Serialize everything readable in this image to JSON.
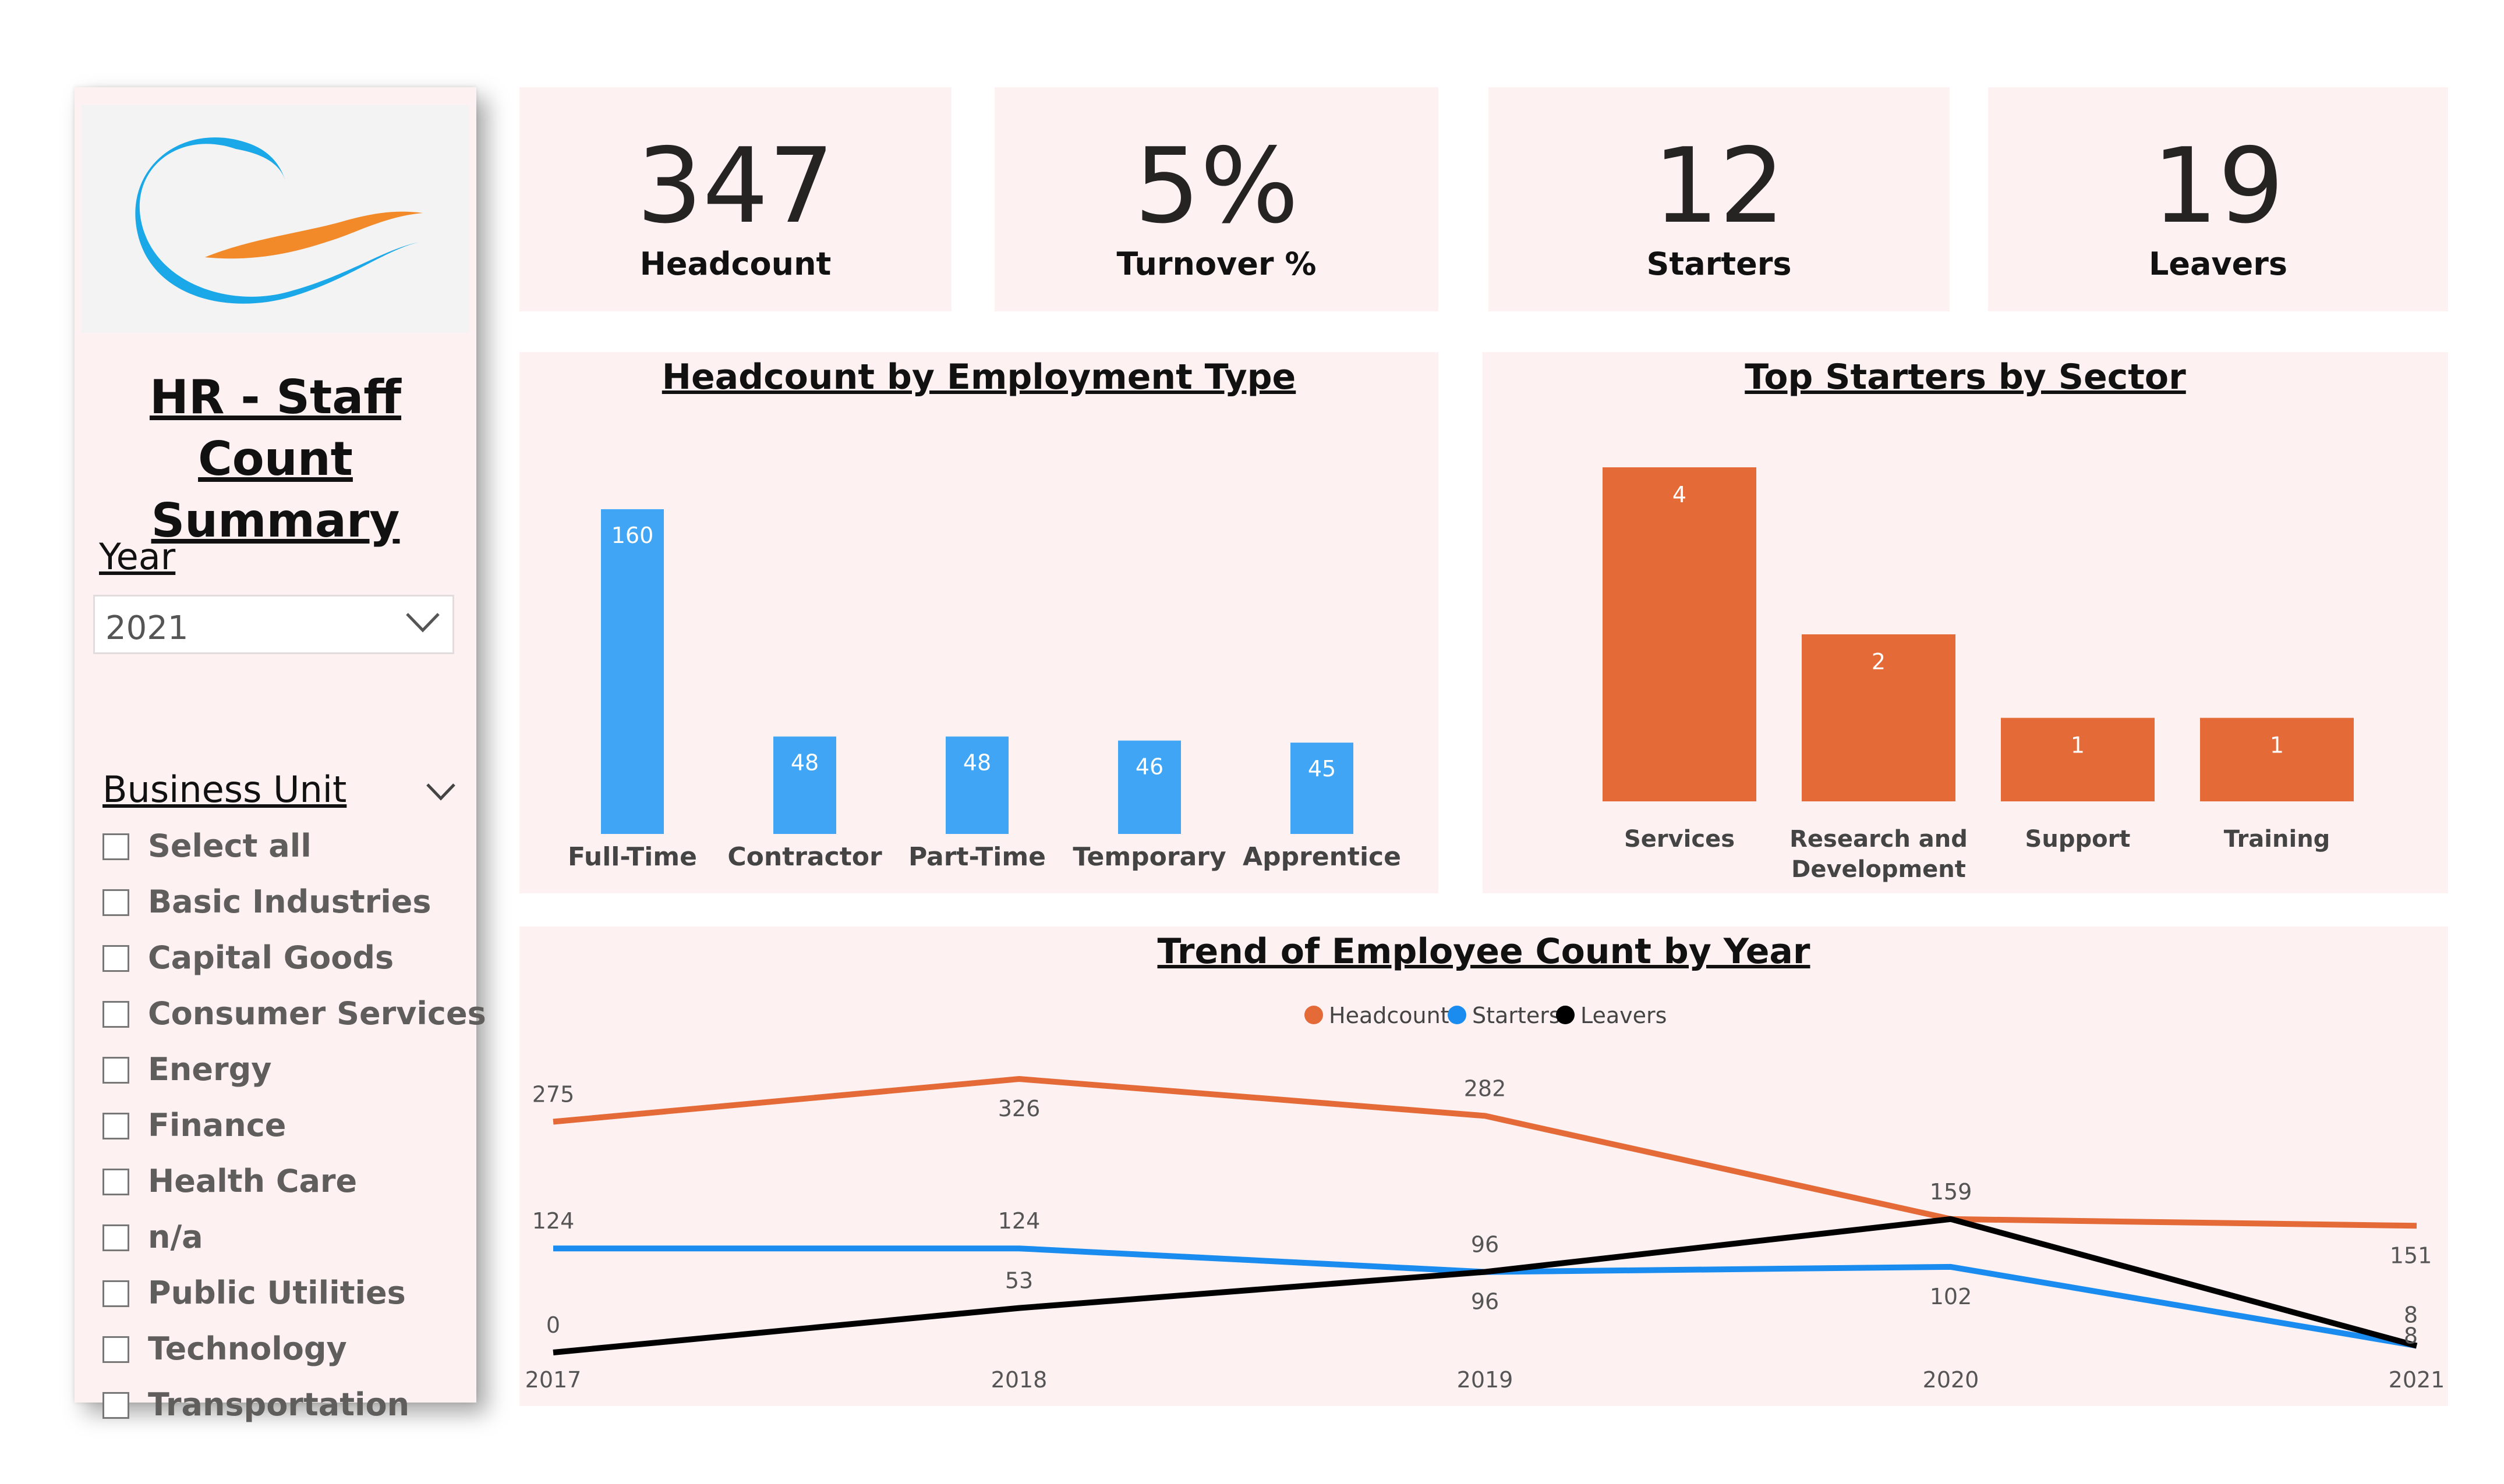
{
  "sidebar": {
    "title_line1": "HR - Staff Count",
    "title_line2": "Summary",
    "year_label": "Year",
    "year_value": "2021",
    "business_unit_label": "Business Unit",
    "business_units": [
      "Select all",
      "Basic Industries",
      "Capital Goods",
      "Consumer Services",
      "Energy",
      "Finance",
      "Health Care",
      "n/a",
      "Public Utilities",
      "Technology",
      "Transportation"
    ],
    "logo_colors": {
      "blue": "#1aa8e8",
      "orange": "#f28a2a"
    }
  },
  "kpis": [
    {
      "value": "347",
      "label": "Headcount"
    },
    {
      "value": "5%",
      "label": "Turnover %"
    },
    {
      "value": "12",
      "label": "Starters"
    },
    {
      "value": "19",
      "label": "Leavers"
    }
  ],
  "chart_data": [
    {
      "type": "bar",
      "title": "Headcount by Employment Type",
      "categories": [
        "Full-Time",
        "Contractor",
        "Part-Time",
        "Temporary",
        "Apprentice"
      ],
      "values": [
        160,
        48,
        48,
        46,
        45
      ],
      "color": "#41a5f5",
      "ylim": [
        0,
        160
      ]
    },
    {
      "type": "bar",
      "title": "Top Starters by Sector",
      "categories": [
        "Services",
        "Research and Development",
        "Support",
        "Training"
      ],
      "values": [
        4,
        2,
        1,
        1
      ],
      "color": "#e46a38",
      "ylim": [
        0,
        4
      ]
    },
    {
      "type": "line",
      "title": "Trend of Employee Count by Year",
      "x": [
        "2017",
        "2018",
        "2019",
        "2020",
        "2021"
      ],
      "series": [
        {
          "name": "Headcount",
          "values": [
            275,
            326,
            282,
            159,
            151
          ],
          "color": "#e46a38"
        },
        {
          "name": "Starters",
          "values": [
            124,
            124,
            96,
            102,
            8
          ],
          "color": "#1a8cf0"
        },
        {
          "name": "Leavers",
          "values": [
            0,
            53,
            96,
            159,
            8
          ],
          "color": "#000000"
        }
      ],
      "legend_position": "top-center",
      "ylim": [
        0,
        326
      ]
    }
  ]
}
